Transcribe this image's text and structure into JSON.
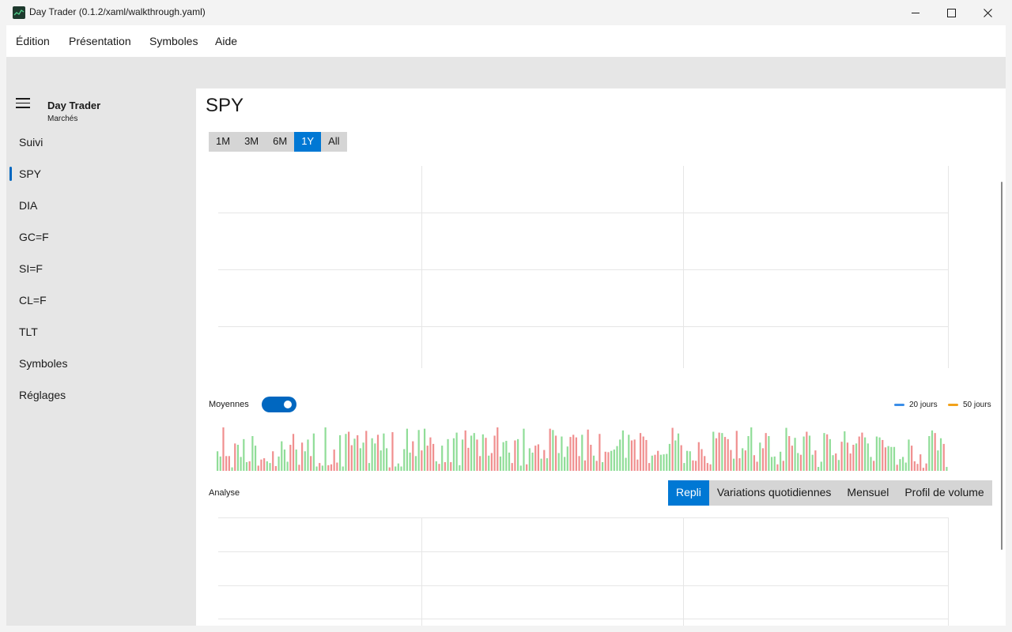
{
  "window": {
    "title": "Day Trader (0.1.2/xaml/walkthrough.yaml)"
  },
  "menu": [
    "Édition",
    "Présentation",
    "Symboles",
    "Aide"
  ],
  "nav": {
    "title": "Day Trader",
    "subtitle": "Marchés",
    "items": [
      {
        "label": "Suivi",
        "selected": false
      },
      {
        "label": "SPY",
        "selected": true
      },
      {
        "label": "DIA",
        "selected": false
      },
      {
        "label": "GC=F",
        "selected": false
      },
      {
        "label": "SI=F",
        "selected": false
      },
      {
        "label": "CL=F",
        "selected": false
      },
      {
        "label": "TLT",
        "selected": false
      },
      {
        "label": "Symboles",
        "selected": false
      },
      {
        "label": "Réglages",
        "selected": false
      }
    ]
  },
  "page": {
    "title": "SPY",
    "ranges": [
      {
        "label": "1M",
        "active": false
      },
      {
        "label": "3M",
        "active": false
      },
      {
        "label": "6M",
        "active": false
      },
      {
        "label": "1Y",
        "active": true
      },
      {
        "label": "All",
        "active": false
      }
    ],
    "averages": {
      "label": "Moyennes",
      "enabled": true,
      "legend": [
        {
          "label": "20 jours",
          "color": "#3b8ee8"
        },
        {
          "label": "50 jours",
          "color": "#f2a21b"
        }
      ]
    },
    "analysis": {
      "label": "Analyse",
      "tabs": [
        {
          "label": "Repli",
          "active": true
        },
        {
          "label": "Variations quotidiennes",
          "active": false
        },
        {
          "label": "Mensuel",
          "active": false
        },
        {
          "label": "Profil de volume",
          "active": false
        }
      ]
    }
  },
  "colors": {
    "accent": "#0078d4",
    "up": "#90dd98",
    "down": "#f08f8f",
    "grid": "#e6e6e6"
  },
  "chart_data": {
    "type": "bar",
    "title": "",
    "series": [
      {
        "values": [
          0.45,
          0.33,
          1.0,
          0.34,
          0.34,
          0.08,
          0.63,
          0.6,
          0.32,
          0.73,
          0.2,
          0.22,
          0.8,
          0.58,
          0.12,
          0.26,
          0.29,
          0.22,
          0.18,
          0.45,
          0.11,
          0.33,
          0.68,
          0.49,
          0.21,
          0.6,
          0.85,
          0.49,
          0.14,
          0.65,
          0.45,
          0.72,
          0.34,
          0.86,
          0.1,
          0.18,
          0.12,
          1.0,
          0.13,
          0.15,
          0.49,
          0.19,
          0.82,
          0.1,
          0.85,
          0.9,
          0.59,
          0.74,
          0.82,
          0.52,
          0.65,
          0.92,
          0.18,
          0.75,
          0.63,
          0.83,
          0.47,
          0.86,
          0.52,
          0.08,
          0.89,
          0.1,
          0.17,
          0.1,
          0.5,
          0.97,
          0.42,
          0.68,
          0.34,
          0.94,
          0.47,
          0.97,
          0.58,
          0.77,
          0.62,
          0.22,
          0.16,
          0.58,
          0.2,
          0.73,
          0.2,
          0.75,
          0.88,
          0.13,
          0.72,
          0.93,
          0.53,
          0.81,
          0.87,
          0.72,
          0.34,
          0.84,
          0.76,
          0.35,
          0.41,
          0.81,
          1.0,
          0.33,
          0.66,
          0.69,
          0.42,
          0.18,
          0.7,
          0.73,
          0.12,
          0.97,
          0.15,
          0.52,
          0.42,
          0.58,
          0.61,
          0.28,
          0.48,
          0.29,
          0.97,
          0.94,
          0.81,
          0.41,
          0.79,
          0.32,
          0.56,
          0.78,
          0.83,
          0.77,
          0.34,
          0.83,
          0.24,
          0.95,
          0.6,
          0.35,
          0.23,
          0.85,
          0.2,
          0.44,
          0.43,
          0.46,
          0.49,
          0.57,
          0.72,
          0.93,
          0.3,
          0.83,
          0.7,
          0.72,
          0.26,
          0.87,
          0.79,
          0.71,
          0.18,
          0.35,
          0.37,
          0.46,
          0.37,
          0.38,
          0.39,
          0.62,
          0.99,
          0.7,
          0.86,
          0.59,
          0.18,
          0.46,
          0.45,
          0.24,
          0.23,
          0.66,
          0.5,
          0.34,
          0.18,
          0.15,
          0.9,
          0.75,
          0.88,
          0.87,
          0.78,
          0.73,
          0.48,
          0.28,
          0.92,
          0.29,
          0.52,
          0.47,
          0.8,
          1.0,
          0.36,
          0.21,
          0.65,
          0.52,
          0.87,
          0.8,
          0.32,
          0.33,
          0.15,
          0.44,
          0.23,
          0.99,
          0.8,
          0.58,
          0.76,
          0.41,
          0.37,
          0.79,
          0.9,
          0.81,
          0.37,
          0.47,
          0.09,
          0.21,
          0.87,
          0.84,
          0.73,
          0.36,
          0.4,
          0.25,
          0.67,
          0.91,
          0.65,
          0.4,
          0.6,
          0.63,
          0.79,
          0.88,
          0.77,
          0.63,
          0.32,
          0.23,
          0.79,
          0.77,
          0.71,
          0.54,
          0.57,
          0.55,
          0.55,
          0.14,
          0.27,
          0.32,
          0.19,
          0.72,
          0.58,
          0.22,
          0.16,
          0.38,
          0.07,
          0.17,
          0.8,
          0.93,
          0.87,
          0.47,
          0.75,
          0.62,
          0.09
        ],
        "up": [
          1,
          1,
          0,
          0,
          0,
          1,
          0,
          1,
          1,
          1,
          1,
          0,
          1,
          1,
          0,
          0,
          0,
          1,
          1,
          0,
          0,
          1,
          1,
          1,
          1,
          0,
          0,
          1,
          0,
          0,
          1,
          1,
          0,
          1,
          1,
          0,
          1,
          1,
          0,
          0,
          0,
          0,
          1,
          1,
          1,
          0,
          0,
          1,
          0,
          1,
          1,
          0,
          1,
          1,
          1,
          0,
          1,
          1,
          1,
          0,
          0,
          1,
          1,
          1,
          1,
          1,
          1,
          0,
          1,
          1,
          0,
          1,
          0,
          0,
          0,
          1,
          0,
          1,
          0,
          1,
          0,
          1,
          1,
          1,
          1,
          0,
          0,
          1,
          1,
          0,
          0,
          1,
          0,
          1,
          0,
          0,
          0,
          1,
          1,
          1,
          1,
          0,
          0,
          1,
          1,
          1,
          0,
          1,
          1,
          0,
          0,
          1,
          0,
          1,
          0,
          1,
          0,
          1,
          1,
          1,
          1,
          0,
          0,
          0,
          0,
          1,
          0,
          0,
          0,
          1,
          0,
          0,
          1,
          0,
          0,
          1,
          1,
          1,
          1,
          1,
          1,
          1,
          0,
          0,
          0,
          0,
          0,
          0,
          0,
          1,
          0,
          0,
          1,
          1,
          1,
          1,
          0,
          1,
          1,
          0,
          1,
          1,
          1,
          0,
          0,
          0,
          0,
          0,
          0,
          0,
          1,
          0,
          0,
          1,
          0,
          0,
          0,
          1,
          0,
          0,
          1,
          0,
          1,
          1,
          0,
          0,
          1,
          0,
          0,
          1,
          1,
          1,
          0,
          1,
          0,
          1,
          0,
          0,
          1,
          1,
          0,
          1,
          0,
          1,
          1,
          0,
          1,
          1,
          1,
          0,
          1,
          1,
          0,
          1,
          0,
          1,
          0,
          0,
          0,
          1,
          0,
          0,
          1,
          1,
          1,
          0,
          1,
          1,
          0,
          0,
          1,
          1,
          1,
          0,
          1,
          1,
          1,
          1,
          0,
          0,
          0,
          0,
          0,
          0,
          1,
          1,
          0,
          1,
          1,
          0,
          1,
          1,
          0,
          1,
          1,
          1,
          0,
          1
        ]
      }
    ]
  }
}
